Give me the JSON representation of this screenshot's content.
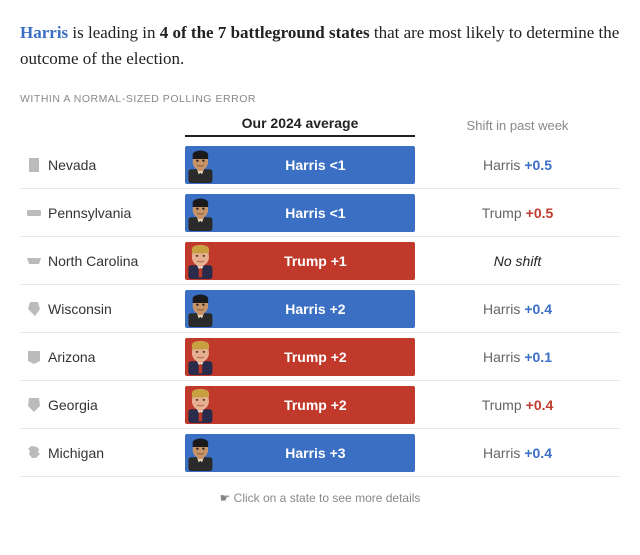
{
  "headline": {
    "prefix": " is leading in ",
    "bold": "4 of the 7 battleground states",
    "suffix": " that are most likely to determine the outcome of the election.",
    "harris_name": "Harris"
  },
  "section_label": "Within a normal-sized polling error",
  "columns": {
    "avg": "Our 2024 average",
    "shift": "Shift in past week"
  },
  "states": [
    {
      "name": "Nevada",
      "icon": "▲",
      "bar_type": "harris",
      "bar_text": "Harris  <1",
      "shift_party": "harris",
      "shift_name": "Harris",
      "shift_value": "+0.5"
    },
    {
      "name": "Pennsylvania",
      "icon": "▬",
      "bar_type": "harris",
      "bar_text": "Harris  <1",
      "shift_party": "trump",
      "shift_name": "Trump",
      "shift_value": "+0.5"
    },
    {
      "name": "North Carolina",
      "icon": "→",
      "bar_type": "trump",
      "bar_text": "Trump  +1",
      "shift_party": "noshift",
      "shift_name": "No shift",
      "shift_value": ""
    },
    {
      "name": "Wisconsin",
      "icon": "▲",
      "bar_type": "harris",
      "bar_text": "Harris  +2",
      "shift_party": "harris",
      "shift_name": "Harris",
      "shift_value": "+0.4"
    },
    {
      "name": "Arizona",
      "icon": "▲",
      "bar_type": "trump",
      "bar_text": "Trump  +2",
      "shift_party": "harris",
      "shift_name": "Harris",
      "shift_value": "+0.1"
    },
    {
      "name": "Georgia",
      "icon": "▲",
      "bar_type": "trump",
      "bar_text": "Trump  +2",
      "shift_party": "trump",
      "shift_name": "Trump",
      "shift_value": "+0.4"
    },
    {
      "name": "Michigan",
      "icon": "▲",
      "bar_type": "harris",
      "bar_text": "Harris  +3",
      "shift_party": "harris",
      "shift_name": "Harris",
      "shift_value": "+0.4"
    }
  ],
  "footer": "Click on a state to see more details",
  "colors": {
    "harris": "#3a6fc4",
    "trump": "#c0392b",
    "noshift": "#222"
  }
}
